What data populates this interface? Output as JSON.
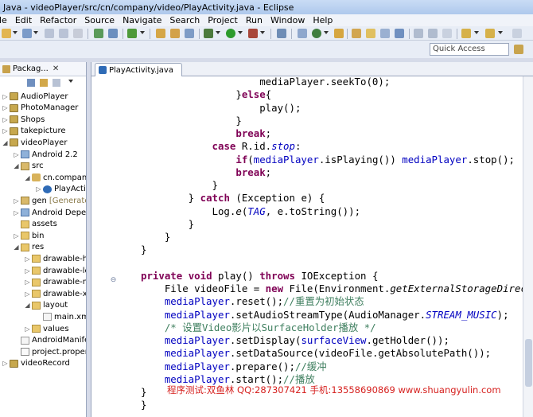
{
  "window": {
    "title": "Java - videoPlayer/src/cn/company/video/PlayActivity.java - Eclipse"
  },
  "menu": [
    "le",
    "Edit",
    "Refactor",
    "Source",
    "Navigate",
    "Search",
    "Project",
    "Run",
    "Window",
    "Help"
  ],
  "quick_access": {
    "placeholder": "Quick Access"
  },
  "package_explorer": {
    "tab_label": "Packag...",
    "close": "✕",
    "items": [
      {
        "label": "AudioPlayer",
        "twisty": "▷"
      },
      {
        "label": "PhotoManager",
        "twisty": "▷"
      },
      {
        "label": "Shops",
        "twisty": "▷"
      },
      {
        "label": "takepicture",
        "twisty": "▷"
      },
      {
        "label": "videoPlayer",
        "twisty": "◢"
      },
      {
        "label": "Android 2.2",
        "twisty": "▷"
      },
      {
        "label": "src",
        "twisty": "◢"
      },
      {
        "label": "cn.company",
        "twisty": "◢"
      },
      {
        "label": "PlayActiv",
        "twisty": "▷"
      },
      {
        "label": "gen",
        "decoration": "[Generate",
        "twisty": "▷"
      },
      {
        "label": "Android Deper",
        "twisty": "▷"
      },
      {
        "label": "assets",
        "twisty": ""
      },
      {
        "label": "bin",
        "twisty": "▷"
      },
      {
        "label": "res",
        "twisty": "◢"
      },
      {
        "label": "drawable-h",
        "twisty": "▷"
      },
      {
        "label": "drawable-lc",
        "twisty": "▷"
      },
      {
        "label": "drawable-m",
        "twisty": "▷"
      },
      {
        "label": "drawable-xl",
        "twisty": "▷"
      },
      {
        "label": "layout",
        "twisty": "◢"
      },
      {
        "label": "main.xm",
        "twisty": ""
      },
      {
        "label": "values",
        "twisty": "▷"
      },
      {
        "label": "AndroidManife",
        "twisty": ""
      },
      {
        "label": "project.proper",
        "twisty": ""
      },
      {
        "label": "videoRecord",
        "twisty": "▷"
      }
    ]
  },
  "editor": {
    "tab_label": "PlayActivity.java",
    "fold_marker": "⊖",
    "lines": [
      [
        {
          "t": "                    mediaPlayer.seekTo(0);"
        }
      ],
      [
        {
          "t": "                }"
        },
        {
          "t": "else",
          "c": "kw"
        },
        {
          "t": "{"
        }
      ],
      [
        {
          "t": "                    play();"
        }
      ],
      [
        {
          "t": "                }"
        }
      ],
      [
        {
          "t": "                "
        },
        {
          "t": "break",
          "c": "kw"
        },
        {
          "t": ";"
        }
      ],
      [
        {
          "t": "            "
        },
        {
          "t": "case",
          "c": "kw"
        },
        {
          "t": " R.id."
        },
        {
          "t": "stop",
          "c": "sfld"
        },
        {
          "t": ":"
        }
      ],
      [
        {
          "t": "                "
        },
        {
          "t": "if",
          "c": "kw"
        },
        {
          "t": "("
        },
        {
          "t": "mediaPlayer",
          "c": "fld"
        },
        {
          "t": ".isPlaying()) "
        },
        {
          "t": "mediaPlayer",
          "c": "fld"
        },
        {
          "t": ".stop();"
        }
      ],
      [
        {
          "t": "                "
        },
        {
          "t": "break",
          "c": "kw"
        },
        {
          "t": ";"
        }
      ],
      [
        {
          "t": "            }"
        }
      ],
      [
        {
          "t": "        } "
        },
        {
          "t": "catch",
          "c": "kw"
        },
        {
          "t": " (Exception e) {"
        }
      ],
      [
        {
          "t": "            Log."
        },
        {
          "t": "e",
          "c": "smeth"
        },
        {
          "t": "("
        },
        {
          "t": "TAG",
          "c": "sfld"
        },
        {
          "t": ", e.toString());"
        }
      ],
      [
        {
          "t": "        }"
        }
      ],
      [
        {
          "t": "    }"
        }
      ],
      [
        {
          "t": "}"
        }
      ],
      [
        {
          "t": ""
        }
      ],
      [
        {
          "t": "private",
          "c": "kw"
        },
        {
          "t": " "
        },
        {
          "t": "void",
          "c": "kw"
        },
        {
          "t": " play() "
        },
        {
          "t": "throws",
          "c": "kw"
        },
        {
          "t": " IOException {"
        }
      ],
      [
        {
          "t": "    File videoFile = "
        },
        {
          "t": "new",
          "c": "kw"
        },
        {
          "t": " File(Environment."
        },
        {
          "t": "getExternalStorageDirec",
          "c": "smeth"
        }
      ],
      [
        {
          "t": "    "
        },
        {
          "t": "mediaPlayer",
          "c": "fld"
        },
        {
          "t": ".reset();"
        },
        {
          "t": "//重置为初始状态",
          "c": "cmt"
        }
      ],
      [
        {
          "t": "    "
        },
        {
          "t": "mediaPlayer",
          "c": "fld"
        },
        {
          "t": ".setAudioStreamType(AudioManager."
        },
        {
          "t": "STREAM_MUSIC",
          "c": "sfld"
        },
        {
          "t": ");"
        }
      ],
      [
        {
          "t": "    "
        },
        {
          "t": "/* 设置Video影片以SurfaceHolder播放 */",
          "c": "cmt"
        }
      ],
      [
        {
          "t": "    "
        },
        {
          "t": "mediaPlayer",
          "c": "fld"
        },
        {
          "t": ".setDisplay("
        },
        {
          "t": "surfaceView",
          "c": "fld"
        },
        {
          "t": ".getHolder());"
        }
      ],
      [
        {
          "t": "    "
        },
        {
          "t": "mediaPlayer",
          "c": "fld"
        },
        {
          "t": ".setDataSource(videoFile.getAbsolutePath());"
        }
      ],
      [
        {
          "t": "    "
        },
        {
          "t": "mediaPlayer",
          "c": "fld"
        },
        {
          "t": ".prepare();"
        },
        {
          "t": "//缓冲",
          "c": "cmt"
        }
      ],
      [
        {
          "t": "    "
        },
        {
          "t": "mediaPlayer",
          "c": "fld"
        },
        {
          "t": ".start();"
        },
        {
          "t": "//播放",
          "c": "cmt"
        }
      ],
      [
        {
          "t": "}"
        }
      ],
      [
        {
          "t": "}"
        }
      ]
    ]
  },
  "watermark": "程序测试:双鱼林 QQ:287307421 手机:13558690869 www.shuangyulin.com",
  "colors": {
    "keyword": "#7f0055",
    "field": "#0000c0",
    "comment": "#3f7f5f",
    "watermark": "#d6211f"
  }
}
